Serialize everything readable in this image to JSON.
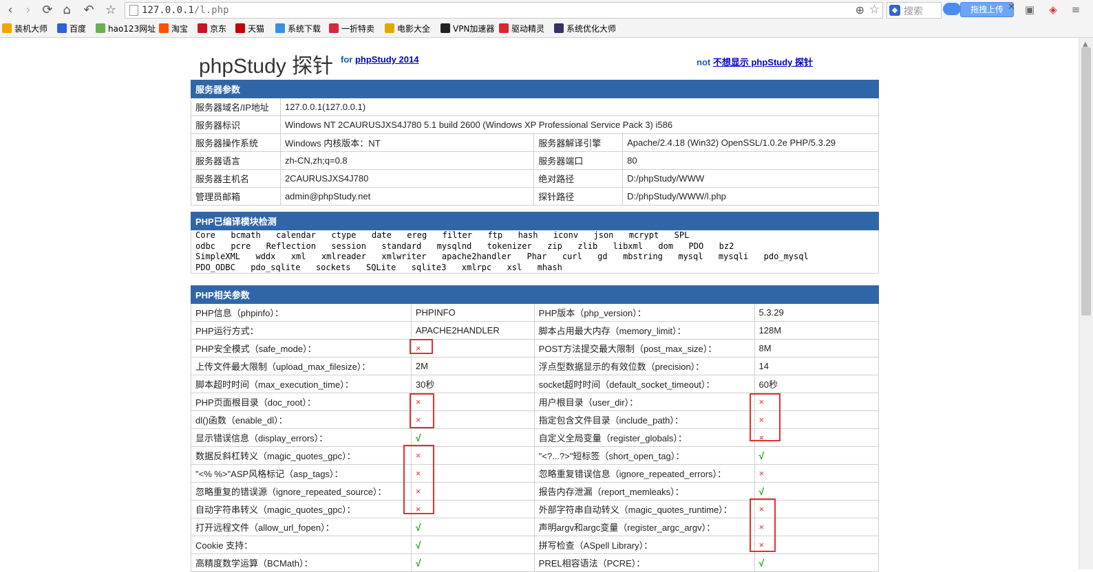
{
  "browser": {
    "address": {
      "host": "127.0.0.1",
      "path": "/l.php"
    },
    "search_placeholder": "搜索",
    "upload_label": "拖拽上传",
    "bookmarks": [
      {
        "label": "装机大师",
        "color": "#f2a500"
      },
      {
        "label": "百度",
        "color": "#2e63d6"
      },
      {
        "label": "hao123网址",
        "color": "#6ab04c"
      },
      {
        "label": "淘宝",
        "color": "#ff5000"
      },
      {
        "label": "京东",
        "color": "#c81623"
      },
      {
        "label": "天猫",
        "color": "#c40000"
      },
      {
        "label": "系统下载",
        "color": "#3a8ee6"
      },
      {
        "label": "一折特卖",
        "color": "#d7263d"
      },
      {
        "label": "电影大全",
        "color": "#e0a800"
      },
      {
        "label": "VPN加速器",
        "color": "#222222"
      },
      {
        "label": "驱动精灵",
        "color": "#d62828"
      },
      {
        "label": "系统优化大师",
        "color": "#333366"
      }
    ]
  },
  "page": {
    "title": "phpStudy 探针",
    "subtitle_prefix": "for",
    "subtitle_link": "phpStudy 2014",
    "hide_prefix": "not",
    "hide_link": "不想显示 phpStudy 探针"
  },
  "server": {
    "header": "服务器参数",
    "domain_label": "服务器域名/IP地址",
    "domain_value": "127.0.0.1(127.0.0.1)",
    "id_label": "服务器标识",
    "id_value": "Windows NT 2CAURUSJXS4J780 5.1 build 2600 (Windows XP Professional Service Pack 3) i586",
    "os_label": "服务器操作系统",
    "os_value": "Windows  内核版本：NT",
    "engine_label": "服务器解译引擎",
    "engine_value": "Apache/2.4.18 (Win32) OpenSSL/1.0.2e PHP/5.3.29",
    "lang_label": "服务器语言",
    "lang_value": "zh-CN,zh;q=0.8",
    "port_label": "服务器端口",
    "port_value": "80",
    "host_label": "服务器主机名",
    "host_value": "2CAURUSJXS4J780",
    "abspath_label": "绝对路径",
    "abspath_value": "D:/phpStudy/WWW",
    "email_label": "管理员邮箱",
    "email_value": "admin@phpStudy.net",
    "probe_label": "探针路径",
    "probe_value": "D:/phpStudy/WWW/l.php"
  },
  "modules": {
    "header": "PHP已编译模块检测",
    "lines": [
      "Core  bcmath  calendar  ctype  date  ereg  filter  ftp  hash  iconv  json  mcrypt  SPL",
      "odbc  pcre  Reflection  session  standard  mysqlnd  tokenizer  zip  zlib  libxml  dom  PDO  bz2",
      "SimpleXML  wddx  xml  xmlreader  xmlwriter  apache2handler  Phar  curl  gd  mbstring  mysql  mysqli  pdo_mysql",
      "PDO_ODBC  pdo_sqlite  sockets  SQLite  sqlite3  xmlrpc  xsl  mhash"
    ]
  },
  "php": {
    "header": "PHP相关参数",
    "rows": [
      {
        "l1": "PHP信息（phpinfo）：",
        "v1": "PHPINFO",
        "l2": "PHP版本（php_version）：",
        "v2": "5.3.29"
      },
      {
        "l1": "PHP运行方式：",
        "v1": "APACHE2HANDLER",
        "l2": "脚本占用最大内存（memory_limit）：",
        "v2": "128M"
      },
      {
        "l1": "PHP安全模式（safe_mode）：",
        "v1": "×",
        "l2": "POST方法提交最大限制（post_max_size）：",
        "v2": "8M"
      },
      {
        "l1": "上传文件最大限制（upload_max_filesize）：",
        "v1": "2M",
        "l2": "浮点型数据显示的有效位数（precision）：",
        "v2": "14"
      },
      {
        "l1": "脚本超时时间（max_execution_time）：",
        "v1": "30秒",
        "l2": "socket超时时间（default_socket_timeout）：",
        "v2": "60秒"
      },
      {
        "l1": "PHP页面根目录（doc_root）：",
        "v1": "×",
        "l2": "用户根目录（user_dir）：",
        "v2": "×"
      },
      {
        "l1": "dl()函数（enable_dl）：",
        "v1": "×",
        "l2": "指定包含文件目录（include_path）：",
        "v2": "×"
      },
      {
        "l1": "显示错误信息（display_errors）：",
        "v1": "√",
        "l2": "自定义全局变量（register_globals）：",
        "v2": "×"
      },
      {
        "l1": "数据反斜杠转义（magic_quotes_gpc）：",
        "v1": "×",
        "l2": "\"<?...?>\"短标签（short_open_tag）：",
        "v2": "√"
      },
      {
        "l1": "\"<% %>\"ASP风格标记（asp_tags）：",
        "v1": "×",
        "l2": "忽略重复错误信息（ignore_repeated_errors）：",
        "v2": "×"
      },
      {
        "l1": "忽略重复的错误源（ignore_repeated_source）：",
        "v1": "×",
        "l2": "报告内存泄漏（report_memleaks）：",
        "v2": "√"
      },
      {
        "l1": "自动字符串转义（magic_quotes_gpc）：",
        "v1": "×",
        "l2": "外部字符串自动转义（magic_quotes_runtime）：",
        "v2": "×"
      },
      {
        "l1": "打开远程文件（allow_url_fopen）：",
        "v1": "√",
        "l2": "声明argv和argc变量（register_argc_argv）：",
        "v2": "×"
      },
      {
        "l1": "Cookie 支持：",
        "v1": "√",
        "l2": "拼写检查（ASpell Library）：",
        "v2": "×"
      },
      {
        "l1": "高精度数学运算（BCMath）：",
        "v1": "√",
        "l2": "PREL相容语法（PCRE）：",
        "v2": "√"
      }
    ]
  }
}
